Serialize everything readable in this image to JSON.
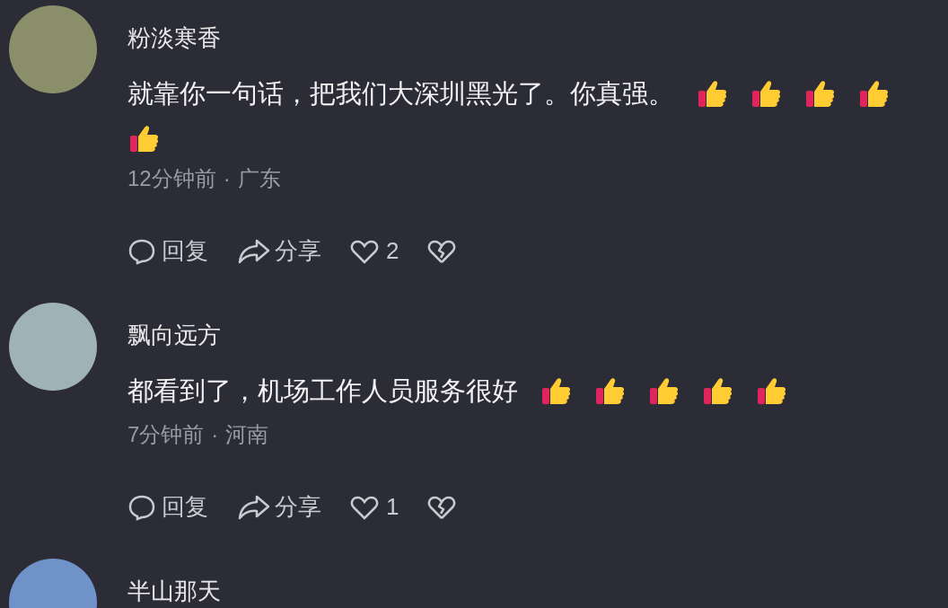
{
  "comments": [
    {
      "name": "粉淡寒香",
      "text": "就靠你一句话，把我们大深圳黑光了。你真强。",
      "reactions": [
        {
          "kind": "thumbs-up"
        },
        {
          "kind": "thumbs-up"
        },
        {
          "kind": "thumbs-up"
        },
        {
          "kind": "thumbs-up"
        },
        {
          "kind": "thumbs-up"
        }
      ],
      "time": "12分钟前",
      "location": "广东",
      "reply": "回复",
      "share": "分享",
      "likes": "2",
      "liked": false
    },
    {
      "name": "飘向远方",
      "text": "都看到了，机场工作人员服务很好",
      "reactions": [
        {
          "kind": "thumbs-up"
        },
        {
          "kind": "thumbs-up"
        },
        {
          "kind": "thumbs-up"
        },
        {
          "kind": "thumbs-up"
        },
        {
          "kind": "thumbs-up"
        }
      ],
      "time": "7分钟前",
      "location": "河南",
      "reply": "回复",
      "share": "分享",
      "likes": "1",
      "liked": false
    },
    {
      "name": "半山那天"
    }
  ],
  "separator": "·"
}
